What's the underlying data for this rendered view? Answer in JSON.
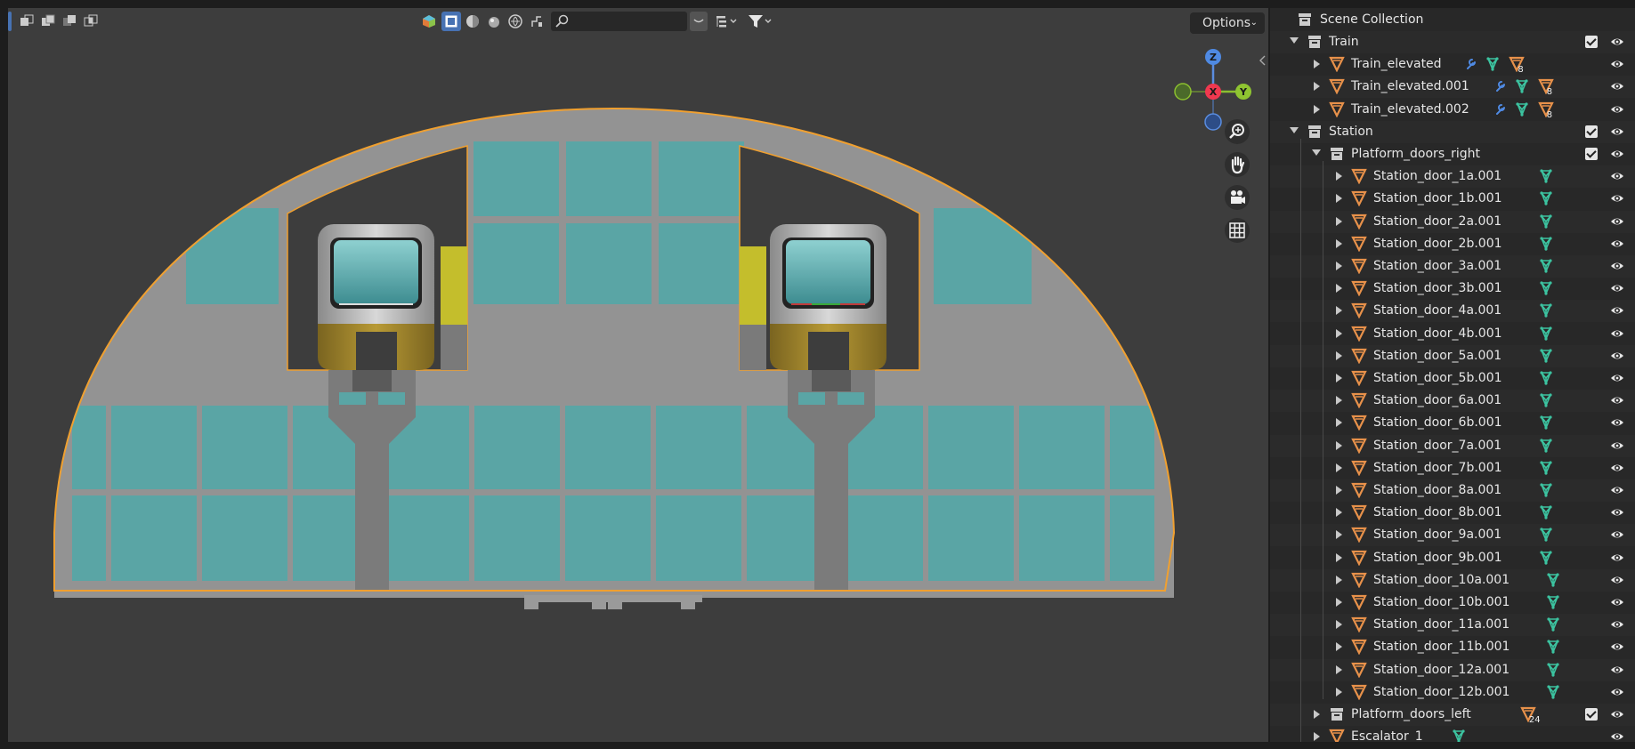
{
  "viewport": {
    "header": {
      "search_placeholder": "",
      "options_label": "Options"
    },
    "gizmo": {
      "z": "Z",
      "x": "X",
      "y": "Y"
    }
  },
  "outliner": {
    "root_label": "Scene Collection",
    "rows": [
      {
        "label": "Train",
        "kind": "collection",
        "depth": 1,
        "open": true,
        "checkbox": true
      },
      {
        "label": "Train_elevated",
        "kind": "object",
        "depth": 2,
        "open": false,
        "mods": true,
        "badge": "8"
      },
      {
        "label": "Train_elevated.001",
        "kind": "object",
        "depth": 2,
        "open": false,
        "mods": true,
        "badge": "8"
      },
      {
        "label": "Train_elevated.002",
        "kind": "object",
        "depth": 2,
        "open": false,
        "mods": true,
        "badge": "8"
      },
      {
        "label": "Station",
        "kind": "collection",
        "depth": 1,
        "open": true,
        "checkbox": true
      },
      {
        "label": "Platform_doors_right",
        "kind": "collection",
        "depth": 2,
        "open": true,
        "checkbox": true
      },
      {
        "label": "Station_door_1a.001",
        "kind": "object",
        "depth": 3
      },
      {
        "label": "Station_door_1b.001",
        "kind": "object",
        "depth": 3
      },
      {
        "label": "Station_door_2a.001",
        "kind": "object",
        "depth": 3
      },
      {
        "label": "Station_door_2b.001",
        "kind": "object",
        "depth": 3
      },
      {
        "label": "Station_door_3a.001",
        "kind": "object",
        "depth": 3
      },
      {
        "label": "Station_door_3b.001",
        "kind": "object",
        "depth": 3
      },
      {
        "label": "Station_door_4a.001",
        "kind": "object",
        "depth": 3
      },
      {
        "label": "Station_door_4b.001",
        "kind": "object",
        "depth": 3
      },
      {
        "label": "Station_door_5a.001",
        "kind": "object",
        "depth": 3
      },
      {
        "label": "Station_door_5b.001",
        "kind": "object",
        "depth": 3
      },
      {
        "label": "Station_door_6a.001",
        "kind": "object",
        "depth": 3
      },
      {
        "label": "Station_door_6b.001",
        "kind": "object",
        "depth": 3
      },
      {
        "label": "Station_door_7a.001",
        "kind": "object",
        "depth": 3
      },
      {
        "label": "Station_door_7b.001",
        "kind": "object",
        "depth": 3
      },
      {
        "label": "Station_door_8a.001",
        "kind": "object",
        "depth": 3
      },
      {
        "label": "Station_door_8b.001",
        "kind": "object",
        "depth": 3
      },
      {
        "label": "Station_door_9a.001",
        "kind": "object",
        "depth": 3
      },
      {
        "label": "Station_door_9b.001",
        "kind": "object",
        "depth": 3
      },
      {
        "label": "Station_door_10a.001",
        "kind": "object",
        "depth": 3
      },
      {
        "label": "Station_door_10b.001",
        "kind": "object",
        "depth": 3
      },
      {
        "label": "Station_door_11a.001",
        "kind": "object",
        "depth": 3
      },
      {
        "label": "Station_door_11b.001",
        "kind": "object",
        "depth": 3
      },
      {
        "label": "Station_door_12a.001",
        "kind": "object",
        "depth": 3
      },
      {
        "label": "Station_door_12b.001",
        "kind": "object",
        "depth": 3
      },
      {
        "label": "Platform_doors_left",
        "kind": "collection",
        "depth": 2,
        "open": false,
        "checkbox": true,
        "badge": "24"
      },
      {
        "label": "Escalator_1",
        "kind": "object",
        "depth": 2,
        "open": false
      }
    ]
  },
  "colors": {
    "selection_outline": "#f0a030",
    "glass": "#5aa5a5",
    "accent_active": "#4772b3",
    "mesh_icon": "#3cc3a0",
    "object_icon": "#e8914a"
  }
}
